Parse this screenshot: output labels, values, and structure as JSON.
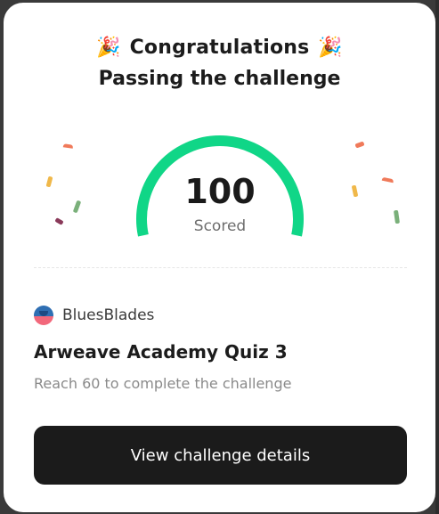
{
  "header": {
    "left_icon": "party-popper-icon",
    "title": "Congratulations",
    "right_icon": "party-popper-icon",
    "party_glyph": "🎉",
    "subtitle": "Passing the challenge"
  },
  "result": {
    "score": "100",
    "score_label": "Scored",
    "gauge_fraction": 1.0,
    "gauge_color": "#10d687"
  },
  "challenge": {
    "author": "BluesBlades",
    "title": "Arweave Academy Quiz 3",
    "requirement": "Reach 60 to complete the challenge"
  },
  "actions": {
    "view_details_label": "View challenge details"
  },
  "colors": {
    "confetti": [
      "#f07a5a",
      "#f0b84a",
      "#7ab07a",
      "#8a3a5a"
    ]
  }
}
